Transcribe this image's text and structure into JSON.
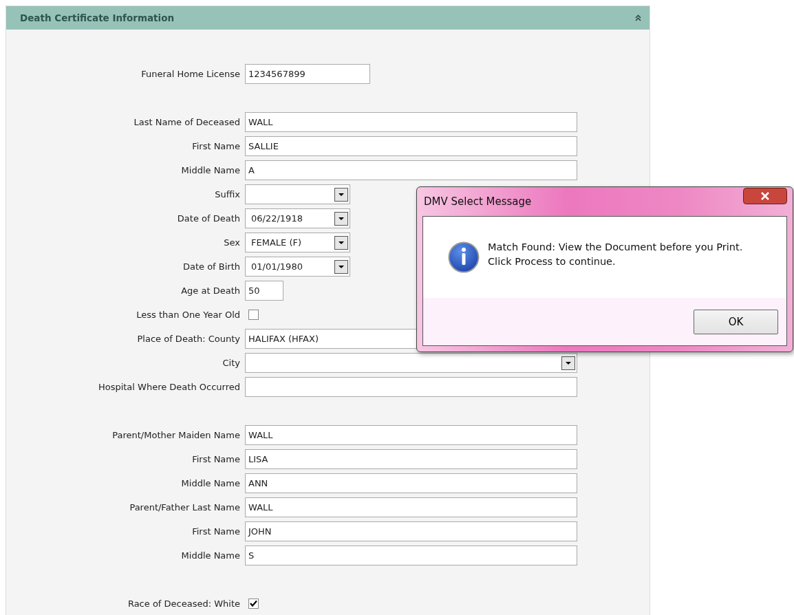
{
  "panel": {
    "title": "Death Certificate Information"
  },
  "groups": [
    {
      "fields": [
        {
          "label": "Funeral Home License",
          "kind": "text",
          "value": "1234567899"
        }
      ]
    },
    {
      "fields": [
        {
          "label": "Last Name of Deceased",
          "kind": "wide",
          "value": "WALL"
        },
        {
          "label": "First Name",
          "kind": "wide",
          "value": "SALLIE"
        },
        {
          "label": "Middle Name",
          "kind": "wide",
          "value": "A"
        },
        {
          "label": "Suffix",
          "kind": "select"
        },
        {
          "label": "Date of Death",
          "kind": "select",
          "value": "06/22/1918"
        },
        {
          "label": "Sex",
          "kind": "select",
          "value": "FEMALE (F)"
        },
        {
          "label": "Date of Birth",
          "kind": "select",
          "value": "01/01/1980"
        },
        {
          "label": "Age at Death",
          "kind": "short",
          "value": "50"
        },
        {
          "label": "Less than One Year Old",
          "kind": "checkbox",
          "checked": false
        },
        {
          "label": "Place of Death: County",
          "kind": "wide",
          "value": "HALIFAX (HFAX)"
        },
        {
          "label": "City",
          "kind": "wideselect"
        },
        {
          "label": "Hospital Where Death Occurred",
          "kind": "wide"
        }
      ]
    },
    {
      "fields": [
        {
          "label": "Parent/Mother Maiden Name",
          "kind": "wide",
          "value": "WALL"
        },
        {
          "label": "First Name",
          "kind": "wide",
          "value": "LISA"
        },
        {
          "label": "Middle Name",
          "kind": "wide",
          "value": "ANN"
        },
        {
          "label": "Parent/Father Last Name",
          "kind": "wide",
          "value": "WALL"
        },
        {
          "label": "First Name",
          "kind": "wide",
          "value": "JOHN"
        },
        {
          "label": "Middle Name",
          "kind": "wide",
          "value": "S"
        }
      ]
    },
    {
      "fields": [
        {
          "label": "Race of Deceased: White",
          "kind": "checkbox",
          "checked": true
        }
      ]
    }
  ],
  "dialog": {
    "title": "DMV Select Message",
    "message_lines": [
      "Match Found: View the Document before you Print.",
      "Click Process to continue."
    ],
    "button": "OK"
  }
}
